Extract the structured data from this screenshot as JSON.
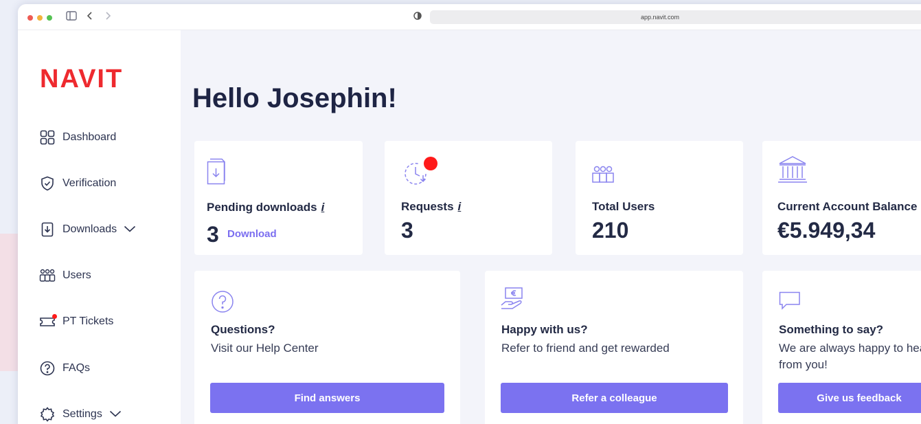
{
  "browser": {
    "url": "app.navit.com"
  },
  "sidebar": {
    "logo": "NAVIT",
    "items": [
      {
        "label": "Dashboard",
        "icon": "dashboard-icon"
      },
      {
        "label": "Verification",
        "icon": "shield-check-icon"
      },
      {
        "label": "Downloads",
        "icon": "download-file-icon",
        "expandable": true
      },
      {
        "label": "Users",
        "icon": "users-icon"
      },
      {
        "label": "PT Tickets",
        "icon": "ticket-icon",
        "badge": true
      },
      {
        "label": "FAQs",
        "icon": "question-icon"
      },
      {
        "label": "Settings",
        "icon": "gear-icon",
        "expandable": true
      }
    ]
  },
  "main": {
    "greeting": "Hello Josephin!",
    "stats": [
      {
        "title": "Pending downloads",
        "info": "i",
        "value": "3",
        "link": "Download",
        "icon": "download-file-icon"
      },
      {
        "title": "Requests",
        "info": "i",
        "value": "3",
        "icon": "clock-request-icon",
        "badge": true
      },
      {
        "title": "Total Users",
        "value": "210",
        "icon": "users-icon"
      },
      {
        "title": "Current Account Balance",
        "value": "€5.949,34",
        "icon": "bank-icon"
      }
    ],
    "cards": [
      {
        "title": "Questions?",
        "text": "Visit our Help Center",
        "button": "Find answers",
        "icon": "question-circle-icon"
      },
      {
        "title": "Happy with us?",
        "text": "Refer to friend and get rewarded",
        "button": "Refer a colleague",
        "icon": "hand-euro-icon"
      },
      {
        "title": "Something to say?",
        "text": "We are always happy to hear from you!",
        "button": "Give us feedback",
        "icon": "chat-bubble-icon"
      }
    ]
  },
  "colors": {
    "brand_red": "#ee2a2f",
    "accent_purple": "#7b72f0",
    "text_dark": "#232a45",
    "icon_purple": "#7b72f0"
  }
}
